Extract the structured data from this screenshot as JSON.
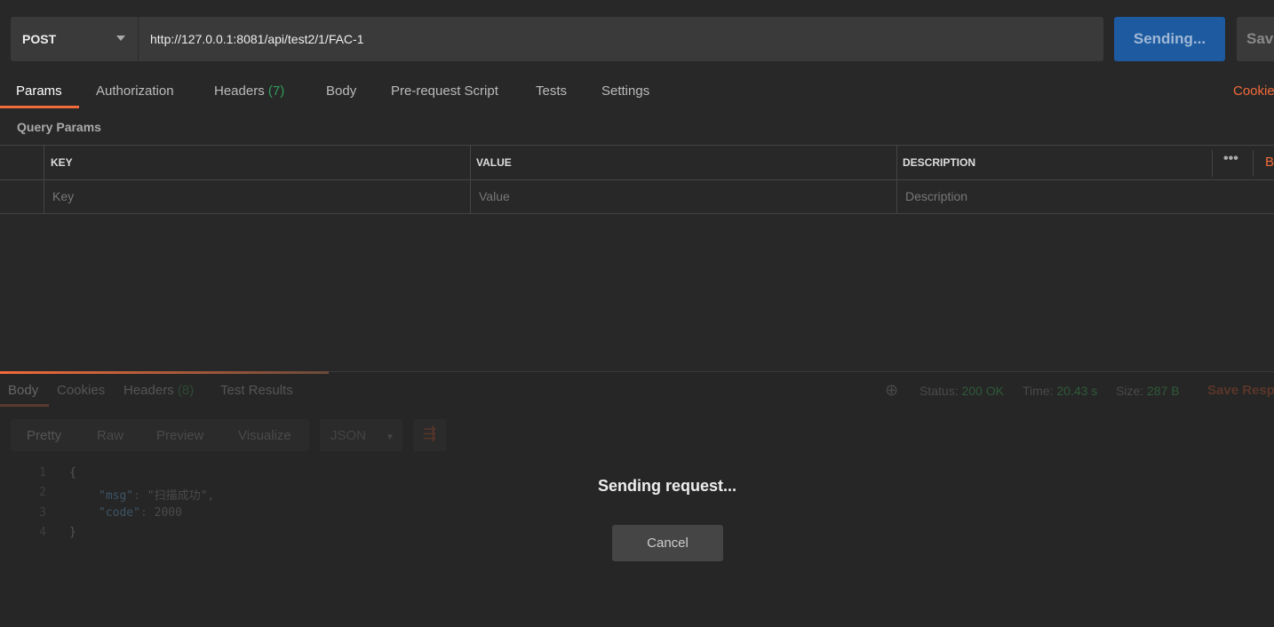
{
  "request": {
    "method": "POST",
    "url": "http://127.0.0.1:8081/api/test2/1/FAC-1",
    "send_label": "Sending...",
    "save_label": "Save"
  },
  "tabs": [
    {
      "label": "Params"
    },
    {
      "label": "Authorization"
    },
    {
      "label": "Headers",
      "count": "(7)"
    },
    {
      "label": "Body"
    },
    {
      "label": "Pre-request Script"
    },
    {
      "label": "Tests"
    },
    {
      "label": "Settings"
    }
  ],
  "cookies_link": "Cookies",
  "query_params": {
    "title": "Query Params",
    "columns": [
      "KEY",
      "VALUE",
      "DESCRIPTION"
    ],
    "placeholders": [
      "Key",
      "Value",
      "Description"
    ],
    "bulk_edit": "Bulk Edit"
  },
  "response": {
    "tabs": [
      {
        "label": "Body"
      },
      {
        "label": "Cookies"
      },
      {
        "label": "Headers",
        "count": "(8)"
      },
      {
        "label": "Test Results"
      }
    ],
    "status_label": "Status:",
    "status": "200 OK",
    "time_label": "Time:",
    "time": "20.43 s",
    "size_label": "Size:",
    "size": "287 B",
    "save_response": "Save Response",
    "formats": [
      "Pretty",
      "Raw",
      "Preview",
      "Visualize"
    ],
    "language": "JSON",
    "lines": [
      {
        "n": "1",
        "text": "{"
      },
      {
        "n": "2",
        "key": "\"msg\"",
        "value": "\"扫描成功\","
      },
      {
        "n": "3",
        "key": "\"code\"",
        "value": "2000"
      },
      {
        "n": "4",
        "text": "}"
      }
    ]
  },
  "overlay": {
    "title": "Sending request...",
    "cancel": "Cancel"
  },
  "colors": {
    "accent": "#f26b3a",
    "send": "#1d5aa0",
    "success": "#2f9e5a"
  }
}
